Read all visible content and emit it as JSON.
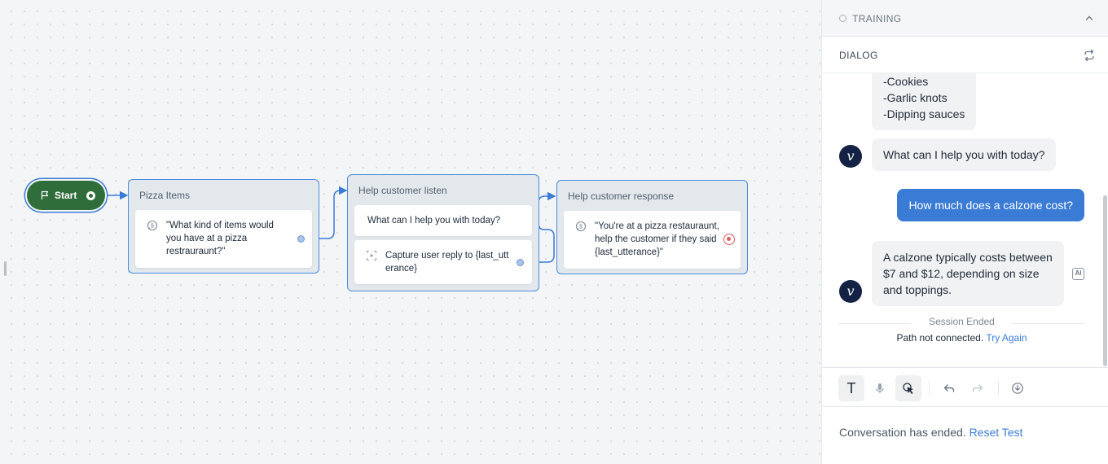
{
  "canvas": {
    "start": {
      "label": "Start"
    },
    "blocks": [
      {
        "title": "Pizza Items",
        "steps": [
          {
            "type": "speak",
            "icon": "speak-icon",
            "lines": [
              "\"What kind of items would",
              "you have at a pizza",
              "restrauraunt?\""
            ]
          }
        ]
      },
      {
        "title": "Help customer listen",
        "steps": [
          {
            "type": "text",
            "lines": [
              "What can I help you with today?"
            ]
          },
          {
            "type": "capture",
            "icon": "capture-icon",
            "lines": [
              "Capture user reply to {last_utt",
              "erance}"
            ]
          }
        ]
      },
      {
        "title": "Help customer response",
        "steps": [
          {
            "type": "speak",
            "icon": "speak-icon",
            "lines": [
              "\"You're at a pizza restauraunt,",
              "help the customer if they said",
              "{last_utterance}\""
            ]
          }
        ]
      }
    ]
  },
  "panel": {
    "training_label": "TRAINING",
    "dialog_label": "DIALOG",
    "messages": [
      {
        "from": "bot",
        "lines": [
          "-Cookies",
          "-Garlic knots",
          "-Dipping sauces"
        ]
      },
      {
        "from": "bot",
        "lines": [
          "What can I help you with today?"
        ]
      },
      {
        "from": "user",
        "lines": [
          "How much does a calzone cost?"
        ]
      },
      {
        "from": "bot",
        "lines": [
          "A calzone typically costs between",
          "$7 and $12, depending on size",
          "and toppings."
        ]
      }
    ],
    "avatar_letter": "v",
    "ai_badge": "AI",
    "session_title": "Session Ended",
    "session_text": "Path not connected.",
    "try_again": "Try Again",
    "toolbar": {
      "text_mode": "T",
      "icons": [
        "text-mode-icon",
        "microphone-icon",
        "click-mode-icon",
        "undo-icon",
        "redo-icon",
        "download-icon"
      ]
    },
    "footer_text": "Conversation has ended.",
    "reset_label": "Reset Test"
  },
  "colors": {
    "accent": "#3a7bd5",
    "start_green": "#2f6e3a",
    "navy": "#132144",
    "end_red": "#e05a5a"
  }
}
